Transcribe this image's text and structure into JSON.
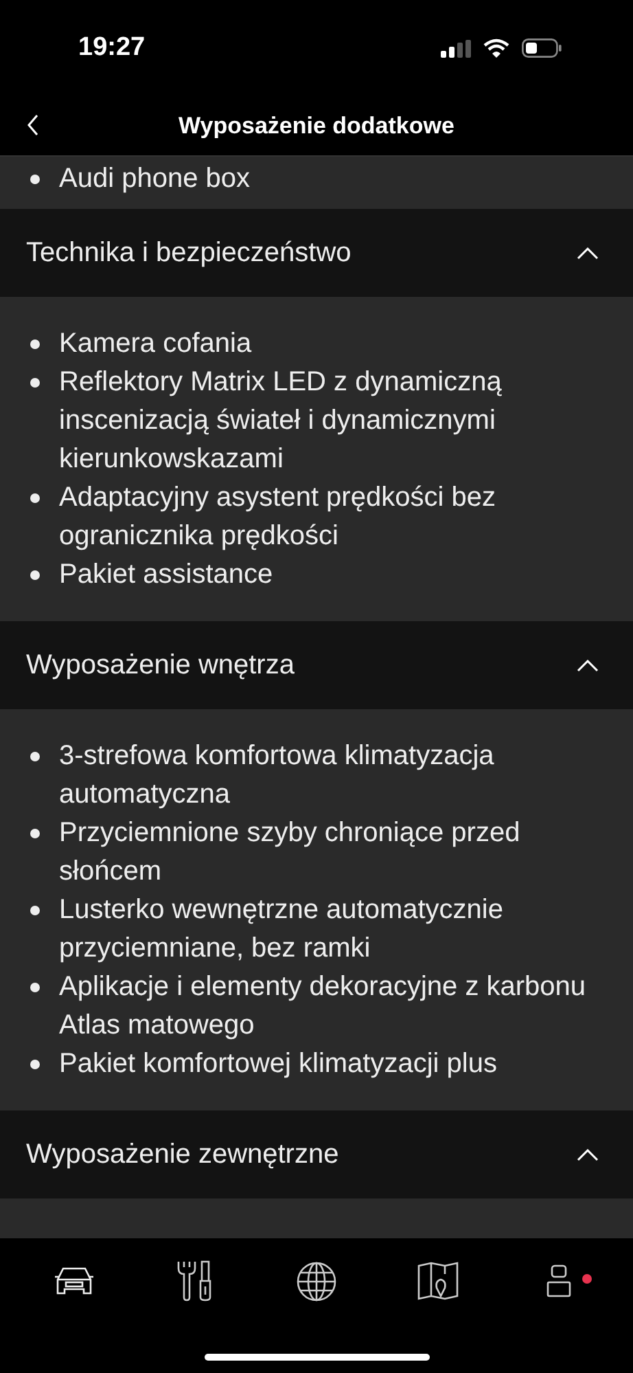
{
  "status_bar": {
    "time": "19:27"
  },
  "header": {
    "title": "Wyposażenie dodatkowe"
  },
  "previous_items": [
    "Audi phone box"
  ],
  "sections": [
    {
      "title": "Technika i bezpieczeństwo",
      "expanded": true,
      "items": [
        "Kamera cofania",
        "Reflektory Matrix LED z dynamiczną inscenizacją świateł i dynamicznymi kierunkowskazami",
        "Adaptacyjny asystent prędkości bez ogranicznika prędkości",
        "Pakiet assistance"
      ]
    },
    {
      "title": "Wyposażenie wnętrza",
      "expanded": true,
      "items": [
        "3-strefowa komfortowa klimatyzacja automatyczna",
        "Przyciemnione szyby chroniące przed słońcem",
        "Lusterko wewnętrzne automatycznie przyciemniane, bez ramki",
        "Aplikacje i elementy dekoracyjne z karbonu Atlas matowego",
        "Pakiet komfortowej klimatyzacji plus"
      ]
    },
    {
      "title": "Wyposażenie zewnętrzne",
      "expanded": true
    }
  ],
  "tab_bar": [
    {
      "kind": "car"
    },
    {
      "kind": "tools"
    },
    {
      "kind": "globe"
    },
    {
      "kind": "map"
    },
    {
      "kind": "profile",
      "notification": true
    }
  ]
}
